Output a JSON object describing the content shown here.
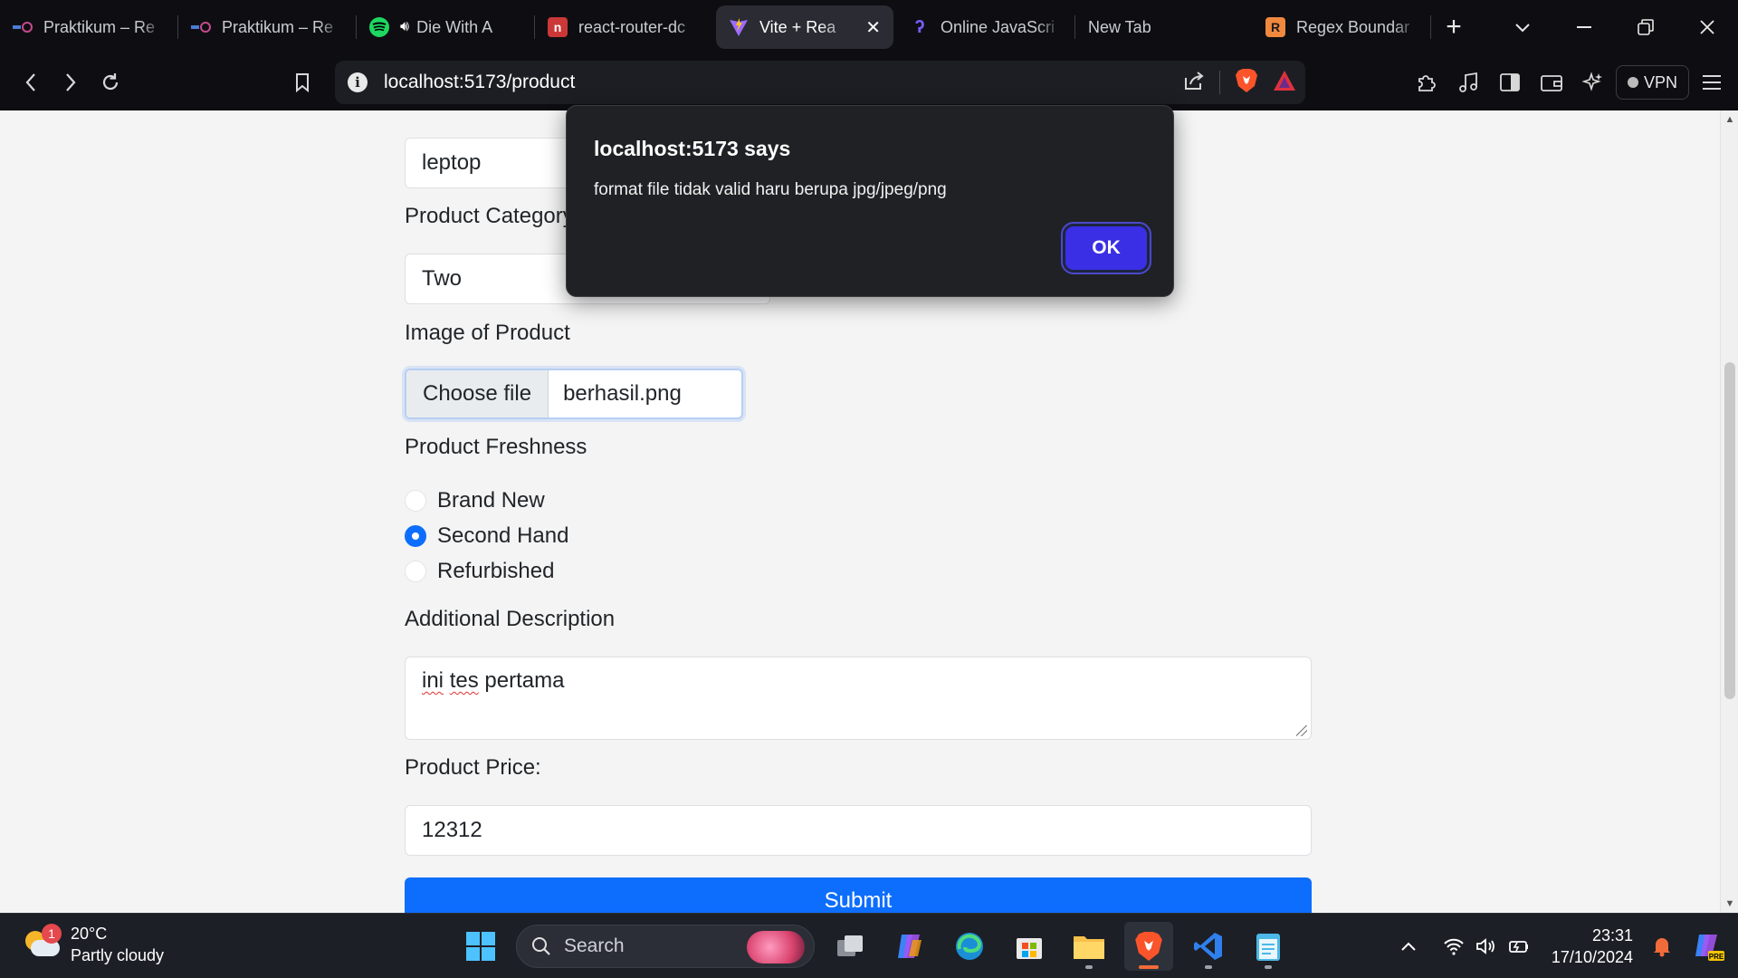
{
  "browser": {
    "tabs": [
      {
        "title": "Praktikum – Re",
        "icon": "praktikum-icon",
        "active": false
      },
      {
        "title": "Praktikum – Re",
        "icon": "praktikum-icon",
        "active": false
      },
      {
        "title": "Die With A",
        "icon": "spotify-icon",
        "active": false,
        "audio": true
      },
      {
        "title": "react-router-dc",
        "icon": "npm-icon",
        "active": false
      },
      {
        "title": "Vite + Rea",
        "icon": "vite-icon",
        "active": true
      },
      {
        "title": "Online JavaScri",
        "icon": "programiz-icon",
        "active": false
      },
      {
        "title": "New Tab",
        "icon": "",
        "active": false
      },
      {
        "title": "Regex Boundar",
        "icon": "regex-icon",
        "active": false
      }
    ],
    "url": {
      "host": "localhost",
      "rest": ":5173/product"
    },
    "vpn_label": "VPN"
  },
  "form": {
    "product_name_value": "leptop",
    "category_label": "Product Category",
    "category_value": "Two",
    "image_label": "Image of Product",
    "file_button_label": "Choose file",
    "file_name": "berhasil.png",
    "freshness_label": "Product Freshness",
    "freshness_options": [
      {
        "label": "Brand New",
        "checked": false
      },
      {
        "label": "Second Hand",
        "checked": true
      },
      {
        "label": "Refurbished",
        "checked": false
      }
    ],
    "description_label": "Additional Description",
    "description_words": {
      "w1": "ini",
      "w2": "tes",
      "w3": "pertama"
    },
    "price_label": "Product Price:",
    "price_value": "12312",
    "submit_label": "Submit"
  },
  "dialog": {
    "title": "localhost:5173 says",
    "message": "format file tidak valid haru berupa jpg/jpeg/png",
    "ok_label": "OK"
  },
  "taskbar": {
    "weather_temp": "20°C",
    "weather_desc": "Partly cloudy",
    "weather_badge": "1",
    "search_placeholder": "Search",
    "time": "23:31",
    "date": "17/10/2024"
  },
  "colors": {
    "primary": "#0d6efd",
    "dialog_bg": "#202124",
    "dialog_ok": "#3a2fe4",
    "browser_chrome": "#0e0e12"
  }
}
